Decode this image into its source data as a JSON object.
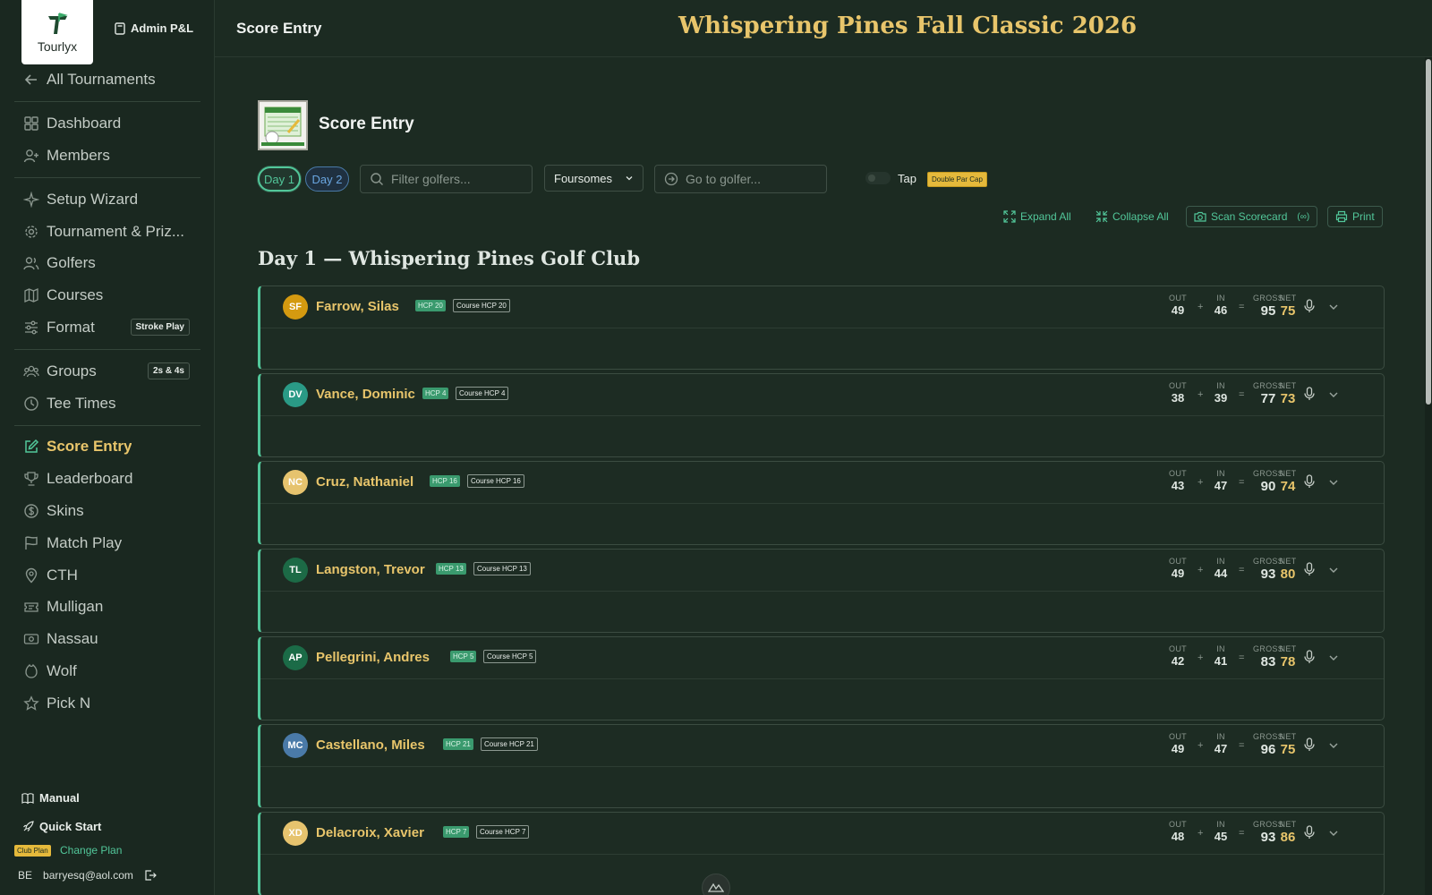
{
  "app": {
    "name": "Tourlyx",
    "admin_label": "Admin P&L"
  },
  "sidebar": {
    "back_label": "All Tournaments",
    "items": [
      {
        "label": "Dashboard",
        "icon": "grid-icon"
      },
      {
        "label": "Members",
        "icon": "user-plus-icon"
      },
      {
        "label": "Setup Wizard",
        "icon": "sparkle-icon"
      },
      {
        "label": "Tournament & Priz...",
        "icon": "gear-icon"
      },
      {
        "label": "Golfers",
        "icon": "users-icon"
      },
      {
        "label": "Courses",
        "icon": "map-icon"
      },
      {
        "label": "Format",
        "icon": "sliders-icon",
        "chip": "Stroke Play"
      },
      {
        "label": "Groups",
        "icon": "group-icon",
        "chip": "2s & 4s"
      },
      {
        "label": "Tee Times",
        "icon": "clock-icon"
      },
      {
        "label": "Score Entry",
        "icon": "edit-icon",
        "active": true
      },
      {
        "label": "Leaderboard",
        "icon": "trophy-icon"
      },
      {
        "label": "Skins",
        "icon": "dollar-icon"
      },
      {
        "label": "Match Play",
        "icon": "flag-icon"
      },
      {
        "label": "CTH",
        "icon": "pin-icon"
      },
      {
        "label": "Mulligan",
        "icon": "ticket-icon"
      },
      {
        "label": "Nassau",
        "icon": "cash-icon"
      },
      {
        "label": "Wolf",
        "icon": "wolf-icon"
      },
      {
        "label": "Pick N",
        "icon": "star-icon"
      }
    ],
    "footer": {
      "manual": "Manual",
      "quick_start": "Quick Start",
      "plan_badge": "Club Plan",
      "change_plan": "Change Plan",
      "user_initials": "BE",
      "user_email": "barryesq@aol.com"
    }
  },
  "topbar": {
    "title": "Score Entry",
    "event_title": "Whispering Pines Fall Classic 2026"
  },
  "main": {
    "heading": "Score Entry",
    "days": [
      "Day 1",
      "Day 2"
    ],
    "filter_placeholder": "Filter golfers...",
    "group_select": "Foursomes",
    "goto_placeholder": "Go to golfer...",
    "tap_label": "Tap",
    "cap_badge": "Double Par Cap",
    "actions": {
      "expand": "Expand All",
      "collapse": "Collapse All",
      "scan": "Scan Scorecard",
      "scan_suffix": "(∞)",
      "print": "Print"
    },
    "section_title": "Day 1 — Whispering Pines Golf Club",
    "stat_labels": {
      "out": "OUT",
      "in": "IN",
      "gross": "GROSS",
      "net": "NET"
    },
    "golfers": [
      {
        "initials": "SF",
        "name": "Farrow, Silas",
        "hcp": "HCP 20",
        "course_hcp": "Course HCP 20",
        "out": "49",
        "in": "46",
        "gross": "95",
        "net": "75",
        "color": "#d49a10"
      },
      {
        "initials": "DV",
        "name": "Vance, Dominic",
        "hcp": "HCP 4",
        "course_hcp": "Course HCP 4",
        "out": "38",
        "in": "39",
        "gross": "77",
        "net": "73",
        "color": "#2a9a86"
      },
      {
        "initials": "NC",
        "name": "Cruz, Nathaniel",
        "hcp": "HCP 16",
        "course_hcp": "Course HCP 16",
        "out": "43",
        "in": "47",
        "gross": "90",
        "net": "74",
        "color": "#e6c36e"
      },
      {
        "initials": "TL",
        "name": "Langston, Trevor",
        "hcp": "HCP 13",
        "course_hcp": "Course HCP 13",
        "out": "49",
        "in": "44",
        "gross": "93",
        "net": "80",
        "color": "#1c6a46"
      },
      {
        "initials": "AP",
        "name": "Pellegrini, Andres",
        "hcp": "HCP 5",
        "course_hcp": "Course HCP 5",
        "out": "42",
        "in": "41",
        "gross": "83",
        "net": "78",
        "color": "#1b6b47"
      },
      {
        "initials": "MC",
        "name": "Castellano, Miles",
        "hcp": "HCP 21",
        "course_hcp": "Course HCP 21",
        "out": "49",
        "in": "47",
        "gross": "96",
        "net": "75",
        "color": "#4a7aa8"
      },
      {
        "initials": "XD",
        "name": "Delacroix, Xavier",
        "hcp": "HCP 7",
        "course_hcp": "Course HCP 7",
        "out": "48",
        "in": "45",
        "gross": "93",
        "net": "86",
        "color": "#e6c36e"
      }
    ]
  }
}
